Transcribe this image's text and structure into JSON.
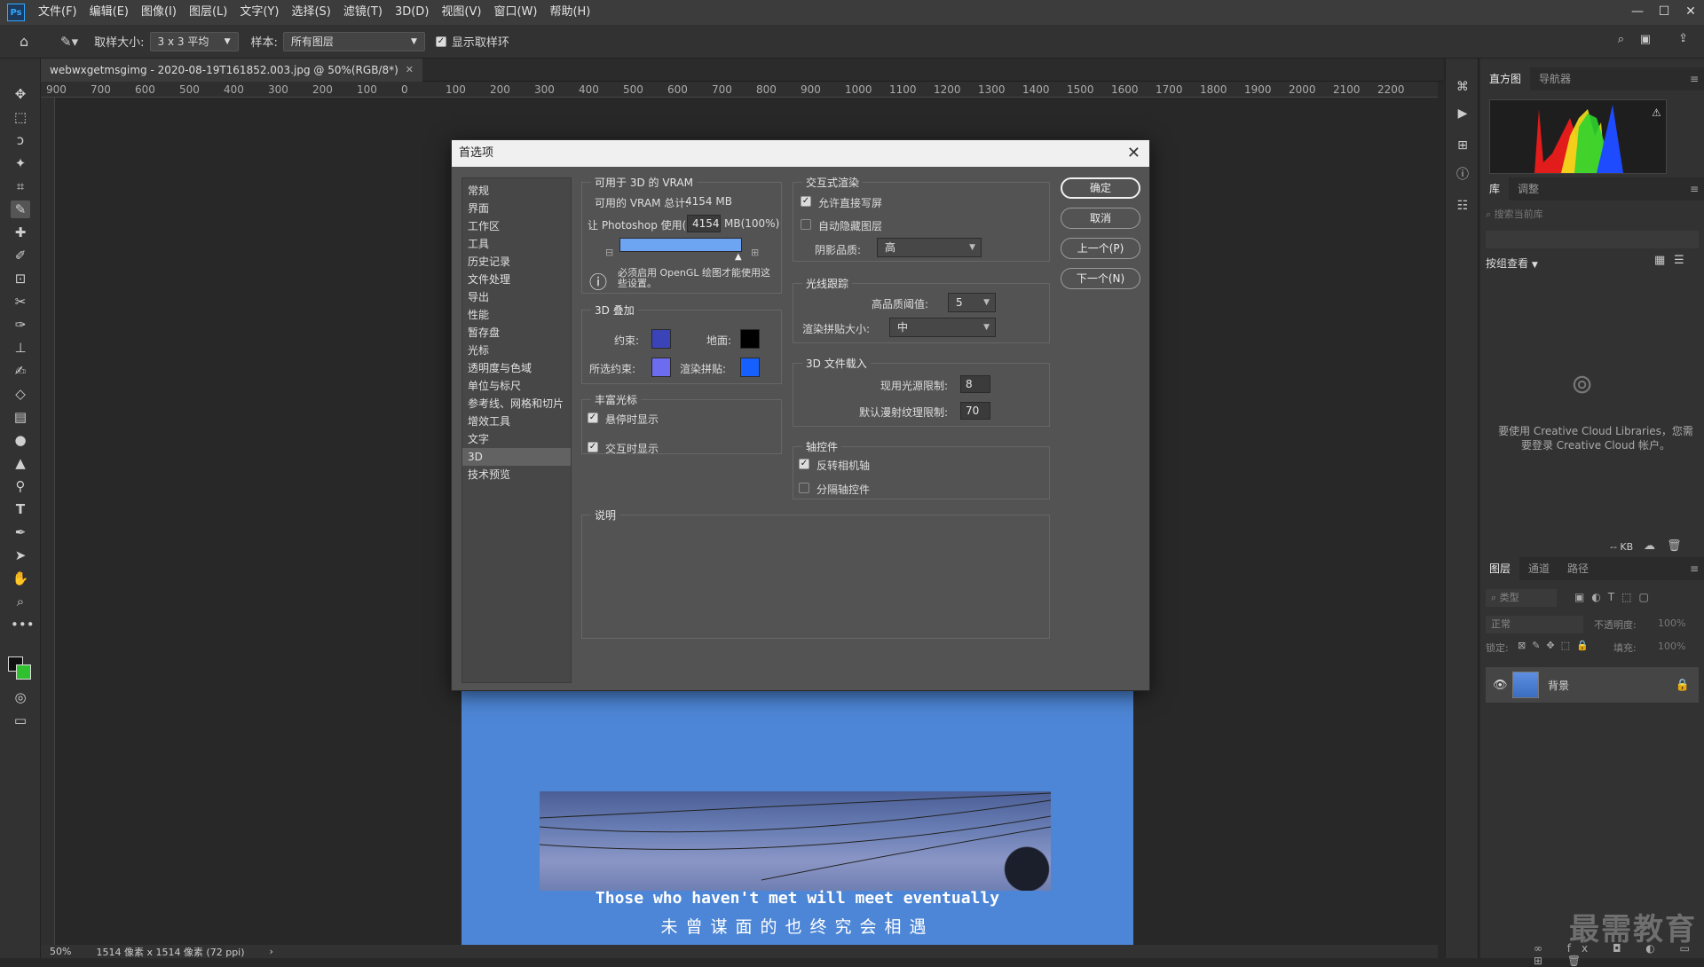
{
  "menubar": {
    "logo": "Ps",
    "items": [
      "文件(F)",
      "编辑(E)",
      "图像(I)",
      "图层(L)",
      "文字(Y)",
      "选择(S)",
      "滤镜(T)",
      "3D(D)",
      "视图(V)",
      "窗口(W)",
      "帮助(H)"
    ]
  },
  "options": {
    "sample_size_label": "取样大小:",
    "sample_size_value": "3 x 3 平均",
    "sample_label": "样本:",
    "sample_value": "所有图层",
    "show_ring_label": "显示取样环",
    "show_ring_checked": true
  },
  "doc": {
    "tab_title": "webwxgetmsgimg - 2020-08-19T161852.003.jpg @ 50%(RGB/8*)",
    "ruler_ticks": [
      "900",
      "700",
      "600",
      "500",
      "400",
      "300",
      "200",
      "100",
      "0",
      "100",
      "200",
      "300",
      "400",
      "500",
      "600",
      "700",
      "800",
      "900",
      "1000",
      "1100",
      "1200",
      "1300",
      "1400",
      "1500",
      "1600",
      "1700",
      "1800",
      "1900",
      "2000",
      "2100",
      "2200"
    ],
    "caption_en": "Those who haven't met will meet eventually",
    "caption_cn": "未曾谋面的也终究会相遇",
    "status_zoom": "50%",
    "status_info": "1514 像素 x 1514 像素 (72 ppi)"
  },
  "dialog": {
    "title": "首选项",
    "nav": [
      "常规",
      "界面",
      "工作区",
      "工具",
      "历史记录",
      "文件处理",
      "导出",
      "性能",
      "暂存盘",
      "光标",
      "透明度与色域",
      "单位与标尺",
      "参考线、网格和切片",
      "增效工具",
      "文字",
      "3D",
      "技术预览"
    ],
    "selected_nav": "3D",
    "vram": {
      "title": "可用于 3D 的 VRAM",
      "total_label": "可用的 VRAM 总计:",
      "total_value": "4154 MB",
      "use_label": "让 Photoshop 使用(L):",
      "use_value": "4154",
      "use_suffix": "MB(100%)",
      "slider_fraction": 1.0,
      "note": "必须启用 OpenGL 绘图才能使用这些设置。"
    },
    "overlay": {
      "title": "3D 叠加",
      "constraint_label": "约束:",
      "constraint_color": "#3a43b8",
      "ground_label": "地面:",
      "ground_color": "#000000",
      "sel_constraint_label": "所选约束:",
      "sel_constraint_color": "#6c6cf0",
      "render_tile_label": "渲染拼贴:",
      "render_tile_color": "#1560ff"
    },
    "rich_cursor": {
      "title": "丰富光标",
      "hover_label": "悬停时显示",
      "hover_checked": true,
      "interact_label": "交互时显示",
      "interact_checked": true
    },
    "description_title": "说明",
    "interactive": {
      "title": "交互式渲染",
      "direct_write_label": "允许直接写屏",
      "direct_write_checked": true,
      "auto_hide_label": "自动隐藏图层",
      "auto_hide_checked": false,
      "shadow_label": "阴影品质:",
      "shadow_value": "高"
    },
    "raytrace": {
      "title": "光线跟踪",
      "threshold_label": "高品质阈值:",
      "threshold_value": "5",
      "tile_label": "渲染拼贴大小:",
      "tile_value": "中"
    },
    "file_load": {
      "title": "3D 文件载入",
      "light_label": "现用光源限制:",
      "light_value": "8",
      "texture_label": "默认漫射纹理限制:",
      "texture_value": "70"
    },
    "axis": {
      "title": "轴控件",
      "invert_label": "反转相机轴",
      "invert_checked": true,
      "separate_label": "分隔轴控件",
      "separate_checked": false
    },
    "buttons": {
      "ok": "确定",
      "cancel": "取消",
      "prev": "上一个(P)",
      "next": "下一个(N)"
    }
  },
  "panels": {
    "histogram_tabs": [
      "直方图",
      "导航器"
    ],
    "library_tabs": [
      "库",
      "调整"
    ],
    "library_search_placeholder": "搜索当前库",
    "view_by": "按组查看",
    "cc_message": "要使用 Creative Cloud Libraries，您需要登录 Creative Cloud 帐户。",
    "size_label": "-- KB",
    "layers_tabs": [
      "图层",
      "通道",
      "路径"
    ],
    "kind_label": "类型",
    "blend_mode": "正常",
    "opacity_label": "不透明度:",
    "opacity_value": "100%",
    "lock_label": "锁定:",
    "fill_label": "填充:",
    "fill_value": "100%",
    "layer_name": "背景"
  },
  "watermark": "最需教育"
}
